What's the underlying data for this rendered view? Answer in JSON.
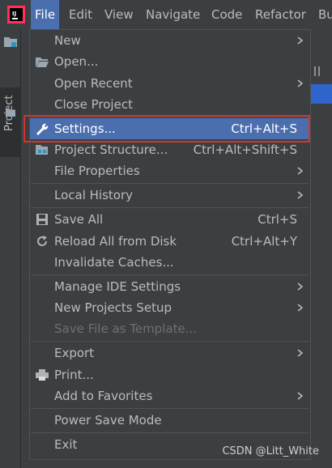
{
  "menubar": {
    "items": [
      {
        "label": "File",
        "active": true
      },
      {
        "label": "Edit"
      },
      {
        "label": "View"
      },
      {
        "label": "Navigate"
      },
      {
        "label": "Code"
      },
      {
        "label": "Refactor"
      },
      {
        "label": "Bu"
      }
    ]
  },
  "toolstrip": {
    "project_tab": "Project"
  },
  "file_menu": {
    "new": "New",
    "open": "Open...",
    "open_recent": "Open Recent",
    "close_project": "Close Project",
    "settings": "Settings...",
    "settings_shortcut": "Ctrl+Alt+S",
    "project_structure": "Project Structure...",
    "project_structure_shortcut": "Ctrl+Alt+Shift+S",
    "file_properties": "File Properties",
    "local_history": "Local History",
    "save_all": "Save All",
    "save_all_shortcut": "Ctrl+S",
    "reload_all": "Reload All from Disk",
    "reload_all_shortcut": "Ctrl+Alt+Y",
    "invalidate_caches": "Invalidate Caches...",
    "manage_ide_settings": "Manage IDE Settings",
    "new_projects_setup": "New Projects Setup",
    "save_file_as_template": "Save File as Template...",
    "export": "Export",
    "print": "Print...",
    "add_to_favorites": "Add to Favorites",
    "power_save_mode": "Power Save Mode",
    "exit": "Exit"
  },
  "watermark": "CSDN @Litt_White",
  "colors": {
    "background": "#3c3f41",
    "selection": "#4b6eaf",
    "highlight_border": "#d0342c",
    "text": "#bbbbbb",
    "disabled_text": "#6f6f6f"
  }
}
